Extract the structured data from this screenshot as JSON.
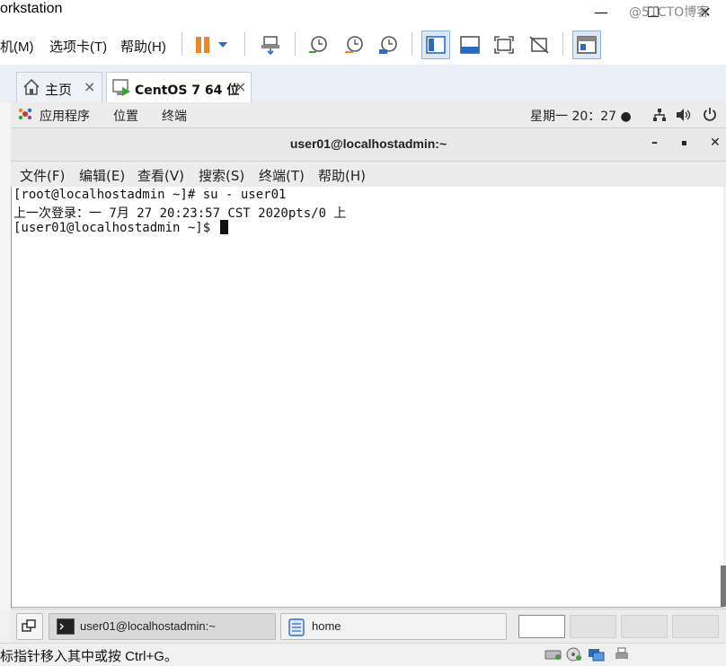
{
  "window": {
    "title": "orkstation",
    "minimize_glyph": "—",
    "maximize_glyph": "☐",
    "close_glyph": "✕"
  },
  "vm_menu": {
    "items": [
      "机(M)",
      "选项卡(T)",
      "帮助(H)"
    ]
  },
  "toolbar": {
    "icons": [
      "pause-icon",
      "dropdown-icon",
      "send-ctrl-alt-del-icon",
      "snapshot-icon",
      "revert-snapshot-icon",
      "snapshot-manager-icon",
      "console-view-icon",
      "thumbnail-view-icon",
      "fullscreen-icon",
      "unity-icon",
      "library-icon"
    ]
  },
  "tabs": [
    {
      "label": "主页",
      "close": "×"
    },
    {
      "label": "CentOS 7 64 位",
      "close": "×"
    }
  ],
  "gnome_panel": {
    "applications": "应用程序",
    "places": "位置",
    "terminal": "终端",
    "clock": "星期一 20：27 ●"
  },
  "terminal": {
    "title": "user01@localhostadmin:~",
    "minimize": "–",
    "maximize": "▪",
    "close": "✕",
    "menu": [
      "文件(F)",
      "编辑(E)",
      "查看(V)",
      "搜索(S)",
      "终端(T)",
      "帮助(H)"
    ],
    "lines": [
      "[root@localhostadmin ~]# su - user01",
      "上一次登录：一 7月 27 20:23:57 CST 2020pts/0 上",
      "[user01@localhostadmin ~]$ "
    ]
  },
  "taskbar": {
    "items": [
      {
        "label": "user01@localhostadmin:~"
      },
      {
        "label": "home"
      }
    ]
  },
  "statusbar": {
    "text": "标指针移入其中或按 Ctrl+G。",
    "watermark": "@51CTO博客"
  },
  "colors": {
    "accent": "#2a6cc4",
    "terminal_bg": "#ffffff",
    "pause_orange": "#e5892a"
  }
}
